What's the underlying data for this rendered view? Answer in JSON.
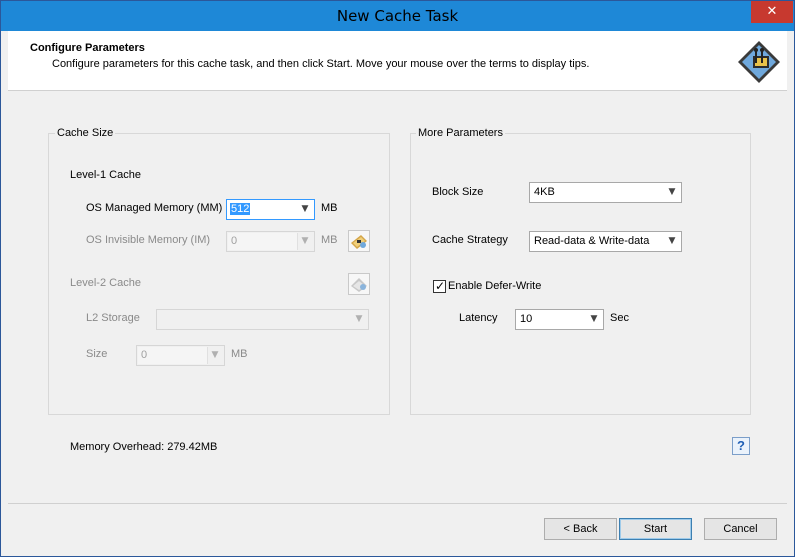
{
  "window": {
    "title": "New Cache Task",
    "close_label": "✕"
  },
  "header": {
    "title": "Configure Parameters",
    "description": "Configure parameters for this cache task, and then click Start. Move your mouse over the terms to display tips."
  },
  "cache_size": {
    "group_title": "Cache Size",
    "level1_label": "Level-1 Cache",
    "os_managed_label": "OS Managed Memory (MM)",
    "os_managed_value": "512",
    "os_managed_unit": "MB",
    "os_invisible_label": "OS Invisible Memory (IM)",
    "os_invisible_value": "0",
    "os_invisible_unit": "MB",
    "level2_label": "Level-2 Cache",
    "l2_storage_label": "L2 Storage",
    "l2_storage_value": "",
    "size_label": "Size",
    "size_value": "0",
    "size_unit": "MB"
  },
  "more_params": {
    "group_title": "More Parameters",
    "block_size_label": "Block Size",
    "block_size_value": "4KB",
    "cache_strategy_label": "Cache Strategy",
    "cache_strategy_value": "Read-data & Write-data",
    "defer_write_label": "Enable Defer-Write",
    "defer_write_checked": true,
    "latency_label": "Latency",
    "latency_value": "10",
    "latency_unit": "Sec"
  },
  "footer": {
    "memory_overhead": "Memory Overhead: 279.42MB",
    "help_label": "?",
    "back_label": "< Back",
    "start_label": "Start",
    "cancel_label": "Cancel"
  },
  "colors": {
    "titlebar": "#1e88d7",
    "close": "#c7392f",
    "selection": "#3399ff"
  }
}
